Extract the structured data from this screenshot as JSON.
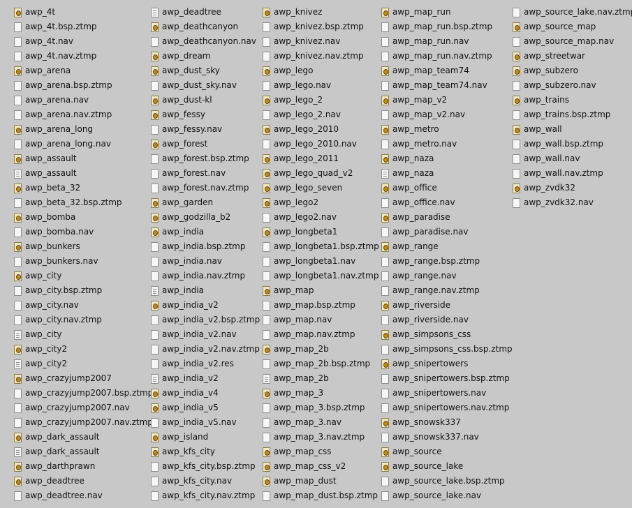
{
  "columns": [
    [
      {
        "name": "awp_4t",
        "icon": "bsp"
      },
      {
        "name": "awp_4t.bsp.ztmp",
        "icon": "blank"
      },
      {
        "name": "awp_4t.nav",
        "icon": "blank"
      },
      {
        "name": "awp_4t.nav.ztmp",
        "icon": "blank"
      },
      {
        "name": "awp_arena",
        "icon": "bsp"
      },
      {
        "name": "awp_arena.bsp.ztmp",
        "icon": "blank"
      },
      {
        "name": "awp_arena.nav",
        "icon": "blank"
      },
      {
        "name": "awp_arena.nav.ztmp",
        "icon": "blank"
      },
      {
        "name": "awp_arena_long",
        "icon": "bsp"
      },
      {
        "name": "awp_arena_long.nav",
        "icon": "blank"
      },
      {
        "name": "awp_assault",
        "icon": "bsp"
      },
      {
        "name": "awp_assault",
        "icon": "text"
      },
      {
        "name": "awp_beta_32",
        "icon": "bsp"
      },
      {
        "name": "awp_beta_32.bsp.ztmp",
        "icon": "blank"
      },
      {
        "name": "awp_bomba",
        "icon": "bsp"
      },
      {
        "name": "awp_bomba.nav",
        "icon": "blank"
      },
      {
        "name": "awp_bunkers",
        "icon": "bsp"
      },
      {
        "name": "awp_bunkers.nav",
        "icon": "blank"
      },
      {
        "name": "awp_city",
        "icon": "bsp"
      },
      {
        "name": "awp_city.bsp.ztmp",
        "icon": "blank"
      },
      {
        "name": "awp_city.nav",
        "icon": "blank"
      },
      {
        "name": "awp_city.nav.ztmp",
        "icon": "blank"
      },
      {
        "name": "awp_city",
        "icon": "text"
      },
      {
        "name": "awp_city2",
        "icon": "bsp"
      },
      {
        "name": "awp_city2",
        "icon": "text"
      },
      {
        "name": "awp_crazyjump2007",
        "icon": "bsp"
      },
      {
        "name": "awp_crazyjump2007.bsp.ztmp",
        "icon": "blank"
      },
      {
        "name": "awp_crazyjump2007.nav",
        "icon": "blank"
      },
      {
        "name": "awp_crazyjump2007.nav.ztmp",
        "icon": "blank"
      },
      {
        "name": "awp_dark_assault",
        "icon": "bsp"
      },
      {
        "name": "awp_dark_assault",
        "icon": "text"
      },
      {
        "name": "awp_darthprawn",
        "icon": "bsp"
      },
      {
        "name": "awp_deadtree",
        "icon": "bsp"
      },
      {
        "name": "awp_deadtree.nav",
        "icon": "blank"
      }
    ],
    [
      {
        "name": "awp_deadtree",
        "icon": "text"
      },
      {
        "name": "awp_deathcanyon",
        "icon": "bsp"
      },
      {
        "name": "awp_deathcanyon.nav",
        "icon": "blank"
      },
      {
        "name": "awp_dream",
        "icon": "bsp"
      },
      {
        "name": "awp_dust_sky",
        "icon": "bsp"
      },
      {
        "name": "awp_dust_sky.nav",
        "icon": "blank"
      },
      {
        "name": "awp_dust-kl",
        "icon": "bsp"
      },
      {
        "name": "awp_fessy",
        "icon": "bsp"
      },
      {
        "name": "awp_fessy.nav",
        "icon": "blank"
      },
      {
        "name": "awp_forest",
        "icon": "bsp"
      },
      {
        "name": "awp_forest.bsp.ztmp",
        "icon": "blank"
      },
      {
        "name": "awp_forest.nav",
        "icon": "blank"
      },
      {
        "name": "awp_forest.nav.ztmp",
        "icon": "blank"
      },
      {
        "name": "awp_garden",
        "icon": "bsp"
      },
      {
        "name": "awp_godzilla_b2",
        "icon": "bsp"
      },
      {
        "name": "awp_india",
        "icon": "bsp"
      },
      {
        "name": "awp_india.bsp.ztmp",
        "icon": "blank"
      },
      {
        "name": "awp_india.nav",
        "icon": "blank"
      },
      {
        "name": "awp_india.nav.ztmp",
        "icon": "blank"
      },
      {
        "name": "awp_india",
        "icon": "text"
      },
      {
        "name": "awp_india_v2",
        "icon": "bsp"
      },
      {
        "name": "awp_india_v2.bsp.ztmp",
        "icon": "blank"
      },
      {
        "name": "awp_india_v2.nav",
        "icon": "blank"
      },
      {
        "name": "awp_india_v2.nav.ztmp",
        "icon": "blank"
      },
      {
        "name": "awp_india_v2.res",
        "icon": "blank"
      },
      {
        "name": "awp_india_v2",
        "icon": "text"
      },
      {
        "name": "awp_india_v4",
        "icon": "bsp"
      },
      {
        "name": "awp_india_v5",
        "icon": "bsp"
      },
      {
        "name": "awp_india_v5.nav",
        "icon": "blank"
      },
      {
        "name": "awp_island",
        "icon": "bsp"
      },
      {
        "name": "awp_kfs_city",
        "icon": "bsp"
      },
      {
        "name": "awp_kfs_city.bsp.ztmp",
        "icon": "blank"
      },
      {
        "name": "awp_kfs_city.nav",
        "icon": "blank"
      },
      {
        "name": "awp_kfs_city.nav.ztmp",
        "icon": "blank"
      }
    ],
    [
      {
        "name": "awp_knivez",
        "icon": "bsp"
      },
      {
        "name": "awp_knivez.bsp.ztmp",
        "icon": "blank"
      },
      {
        "name": "awp_knivez.nav",
        "icon": "blank"
      },
      {
        "name": "awp_knivez.nav.ztmp",
        "icon": "blank"
      },
      {
        "name": "awp_lego",
        "icon": "bsp"
      },
      {
        "name": "awp_lego.nav",
        "icon": "blank"
      },
      {
        "name": "awp_lego_2",
        "icon": "bsp"
      },
      {
        "name": "awp_lego_2.nav",
        "icon": "blank"
      },
      {
        "name": "awp_lego_2010",
        "icon": "bsp"
      },
      {
        "name": "awp_lego_2010.nav",
        "icon": "blank"
      },
      {
        "name": "awp_lego_2011",
        "icon": "bsp"
      },
      {
        "name": "awp_lego_quad_v2",
        "icon": "bsp"
      },
      {
        "name": "awp_lego_seven",
        "icon": "bsp"
      },
      {
        "name": "awp_lego2",
        "icon": "bsp"
      },
      {
        "name": "awp_lego2.nav",
        "icon": "blank"
      },
      {
        "name": "awp_longbeta1",
        "icon": "bsp"
      },
      {
        "name": "awp_longbeta1.bsp.ztmp",
        "icon": "blank"
      },
      {
        "name": "awp_longbeta1.nav",
        "icon": "blank"
      },
      {
        "name": "awp_longbeta1.nav.ztmp",
        "icon": "blank"
      },
      {
        "name": "awp_map",
        "icon": "bsp"
      },
      {
        "name": "awp_map.bsp.ztmp",
        "icon": "blank"
      },
      {
        "name": "awp_map.nav",
        "icon": "blank"
      },
      {
        "name": "awp_map.nav.ztmp",
        "icon": "blank"
      },
      {
        "name": "awp_map_2b",
        "icon": "bsp"
      },
      {
        "name": "awp_map_2b.bsp.ztmp",
        "icon": "blank"
      },
      {
        "name": "awp_map_2b",
        "icon": "text"
      },
      {
        "name": "awp_map_3",
        "icon": "bsp"
      },
      {
        "name": "awp_map_3.bsp.ztmp",
        "icon": "blank"
      },
      {
        "name": "awp_map_3.nav",
        "icon": "blank"
      },
      {
        "name": "awp_map_3.nav.ztmp",
        "icon": "blank"
      },
      {
        "name": "awp_map_css",
        "icon": "bsp"
      },
      {
        "name": "awp_map_css_v2",
        "icon": "bsp"
      },
      {
        "name": "awp_map_dust",
        "icon": "bsp"
      },
      {
        "name": "awp_map_dust.bsp.ztmp",
        "icon": "blank"
      }
    ],
    [
      {
        "name": "awp_map_run",
        "icon": "bsp"
      },
      {
        "name": "awp_map_run.bsp.ztmp",
        "icon": "blank"
      },
      {
        "name": "awp_map_run.nav",
        "icon": "blank"
      },
      {
        "name": "awp_map_run.nav.ztmp",
        "icon": "blank"
      },
      {
        "name": "awp_map_team74",
        "icon": "bsp"
      },
      {
        "name": "awp_map_team74.nav",
        "icon": "blank"
      },
      {
        "name": "awp_map_v2",
        "icon": "bsp"
      },
      {
        "name": "awp_map_v2.nav",
        "icon": "blank"
      },
      {
        "name": "awp_metro",
        "icon": "bsp"
      },
      {
        "name": "awp_metro.nav",
        "icon": "blank"
      },
      {
        "name": "awp_naza",
        "icon": "bsp"
      },
      {
        "name": "awp_naza",
        "icon": "text"
      },
      {
        "name": "awp_office",
        "icon": "bsp"
      },
      {
        "name": "awp_office.nav",
        "icon": "blank"
      },
      {
        "name": "awp_paradise",
        "icon": "bsp"
      },
      {
        "name": "awp_paradise.nav",
        "icon": "blank"
      },
      {
        "name": "awp_range",
        "icon": "bsp"
      },
      {
        "name": "awp_range.bsp.ztmp",
        "icon": "blank"
      },
      {
        "name": "awp_range.nav",
        "icon": "blank"
      },
      {
        "name": "awp_range.nav.ztmp",
        "icon": "blank"
      },
      {
        "name": "awp_riverside",
        "icon": "bsp"
      },
      {
        "name": "awp_riverside.nav",
        "icon": "blank"
      },
      {
        "name": "awp_simpsons_css",
        "icon": "bsp"
      },
      {
        "name": "awp_simpsons_css.bsp.ztmp",
        "icon": "blank"
      },
      {
        "name": "awp_snipertowers",
        "icon": "bsp"
      },
      {
        "name": "awp_snipertowers.bsp.ztmp",
        "icon": "blank"
      },
      {
        "name": "awp_snipertowers.nav",
        "icon": "blank"
      },
      {
        "name": "awp_snipertowers.nav.ztmp",
        "icon": "blank"
      },
      {
        "name": "awp_snowsk337",
        "icon": "bsp"
      },
      {
        "name": "awp_snowsk337.nav",
        "icon": "blank"
      },
      {
        "name": "awp_source",
        "icon": "bsp"
      },
      {
        "name": "awp_source_lake",
        "icon": "bsp"
      },
      {
        "name": "awp_source_lake.bsp.ztmp",
        "icon": "blank"
      },
      {
        "name": "awp_source_lake.nav",
        "icon": "blank"
      }
    ],
    [
      {
        "name": "awp_source_lake.nav.ztmp",
        "icon": "blank"
      },
      {
        "name": "awp_source_map",
        "icon": "bsp"
      },
      {
        "name": "awp_source_map.nav",
        "icon": "blank"
      },
      {
        "name": "awp_streetwar",
        "icon": "bsp"
      },
      {
        "name": "awp_subzero",
        "icon": "bsp"
      },
      {
        "name": "awp_subzero.nav",
        "icon": "blank"
      },
      {
        "name": "awp_trains",
        "icon": "bsp"
      },
      {
        "name": "awp_trains.bsp.ztmp",
        "icon": "blank"
      },
      {
        "name": "awp_wall",
        "icon": "bsp"
      },
      {
        "name": "awp_wall.bsp.ztmp",
        "icon": "blank"
      },
      {
        "name": "awp_wall.nav",
        "icon": "blank"
      },
      {
        "name": "awp_wall.nav.ztmp",
        "icon": "blank"
      },
      {
        "name": "awp_zvdk32",
        "icon": "bsp"
      },
      {
        "name": "awp_zvdk32.nav",
        "icon": "blank"
      }
    ]
  ]
}
